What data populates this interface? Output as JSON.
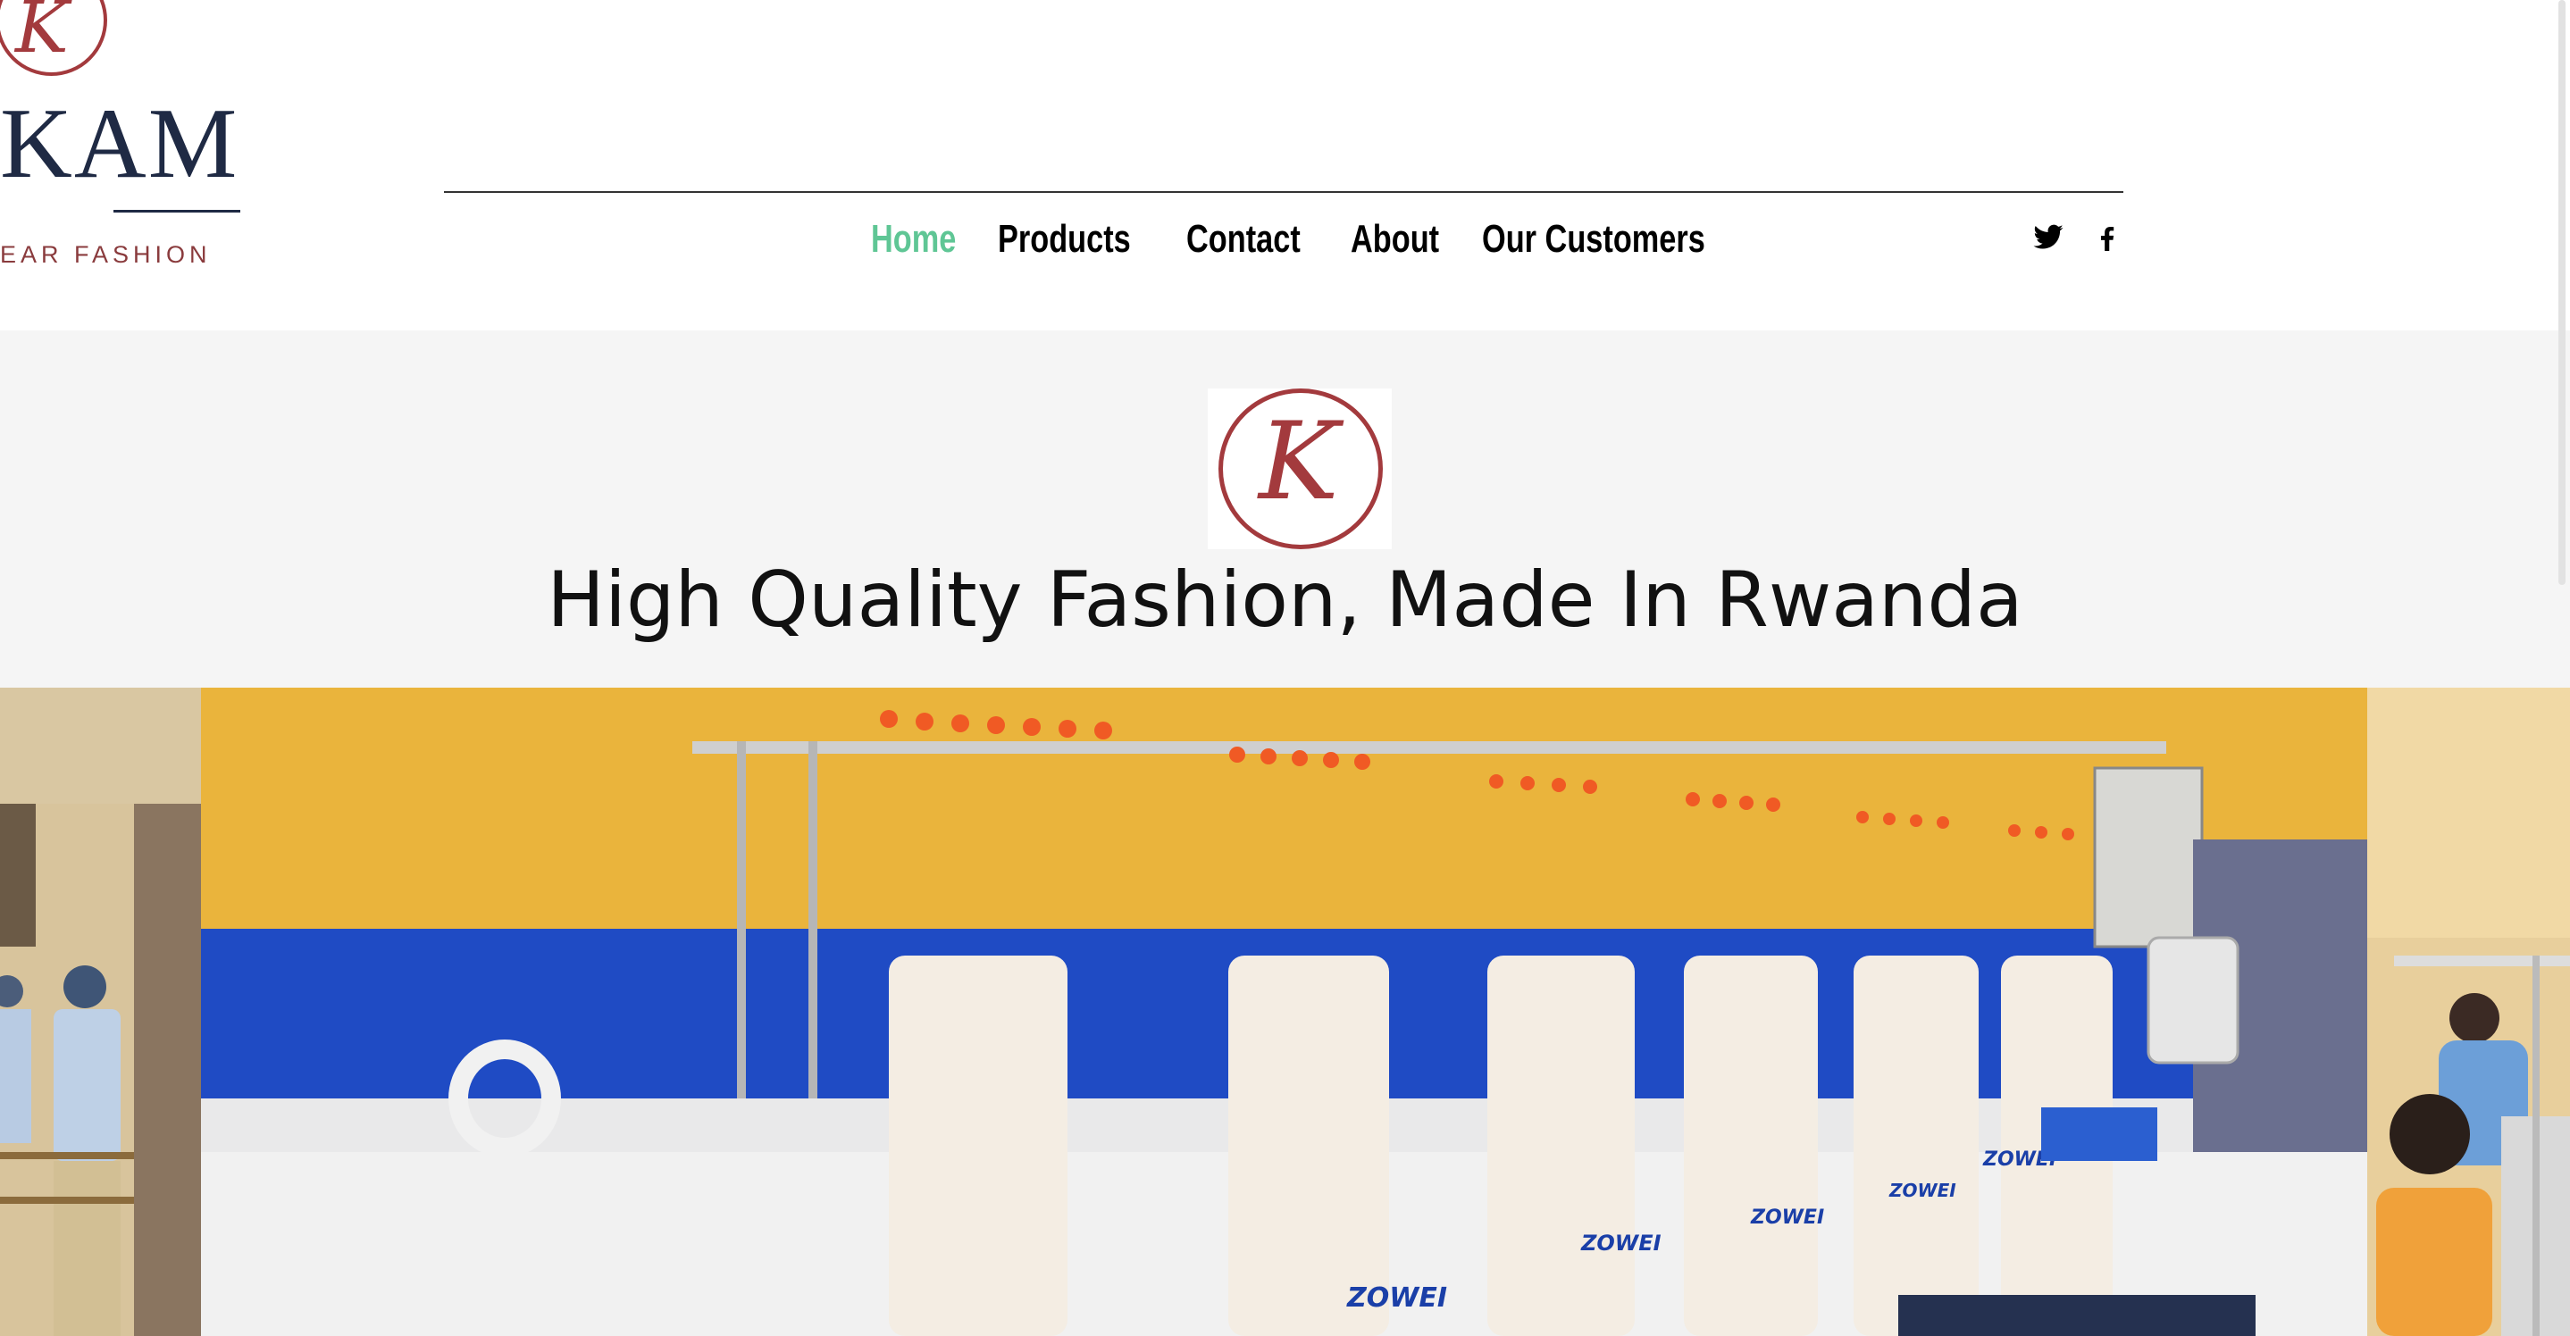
{
  "brand": {
    "mark_letter": "K",
    "name": "KAM",
    "subtitle": "EAR FASHION"
  },
  "nav": {
    "items": [
      {
        "label": "Home",
        "active": true
      },
      {
        "label": "Products",
        "active": false
      },
      {
        "label": "Contact",
        "active": false
      },
      {
        "label": "About",
        "active": false
      },
      {
        "label": "Our Customers",
        "active": false
      }
    ]
  },
  "social": {
    "icons": [
      "twitter-icon",
      "facebook-icon"
    ]
  },
  "hero": {
    "logo_letter": "K",
    "tagline": "High Quality Fashion, Made In Rwanda"
  },
  "gallery": {
    "machine_brand": "ZOWEI",
    "images": [
      "workers-photo",
      "embroidery-machines-photo",
      "sewing-workshop-photo"
    ]
  },
  "colors": {
    "accent_top": "#8e3c8c",
    "active_nav": "#5fc695",
    "brand_red": "#a33a3d",
    "brand_navy": "#1f2a44"
  }
}
